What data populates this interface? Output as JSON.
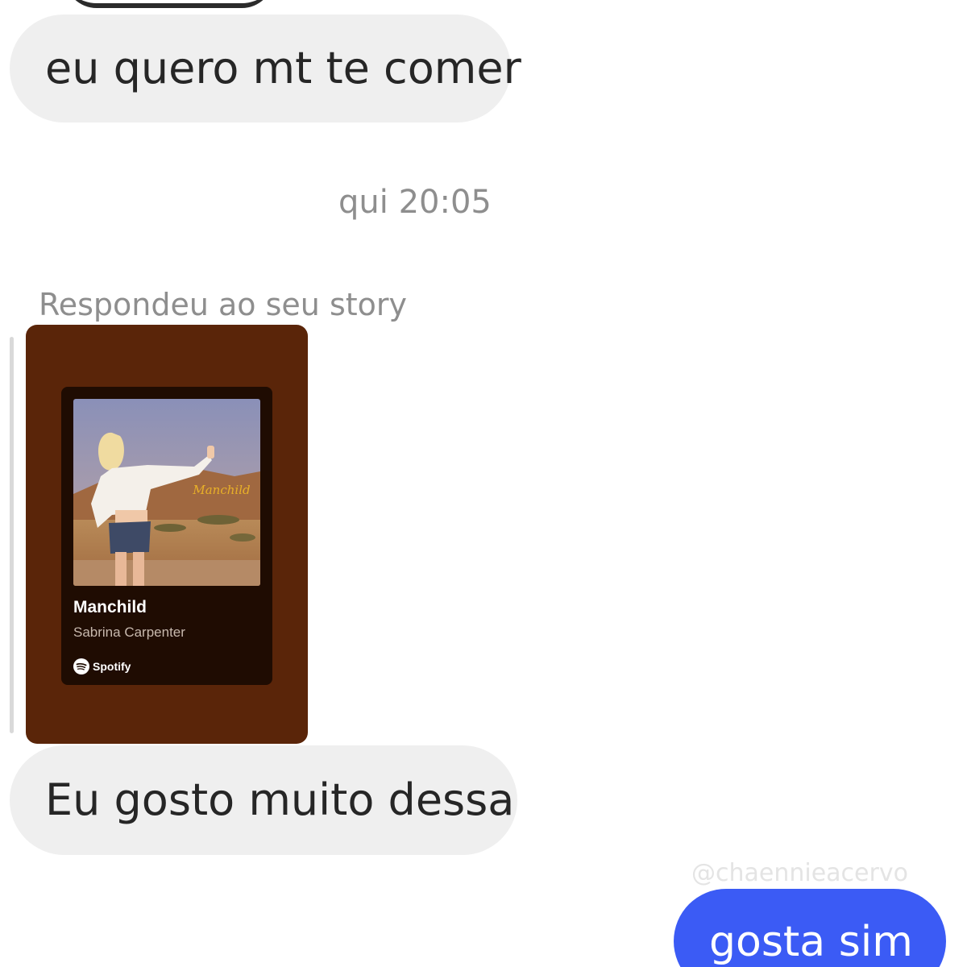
{
  "messages": {
    "first": "eu quero mt te comer",
    "timestamp": "qui 20:05",
    "reply_label": "Respondeu ao seu story",
    "second": "Eu gosto muito dessa",
    "outgoing": "gosta sim"
  },
  "story": {
    "track_title": "Manchild",
    "artist": "Sabrina Carpenter",
    "brand": "Spotify",
    "cover_title": "Manchild"
  },
  "watermark": "@chaennieacervo",
  "colors": {
    "incoming_bubble": "#efefef",
    "outgoing_bubble": "#3b5bf5",
    "story_background": "#5a2509",
    "spotify_card": "#1f0c02"
  },
  "icons": {
    "brand": "spotify-icon"
  }
}
